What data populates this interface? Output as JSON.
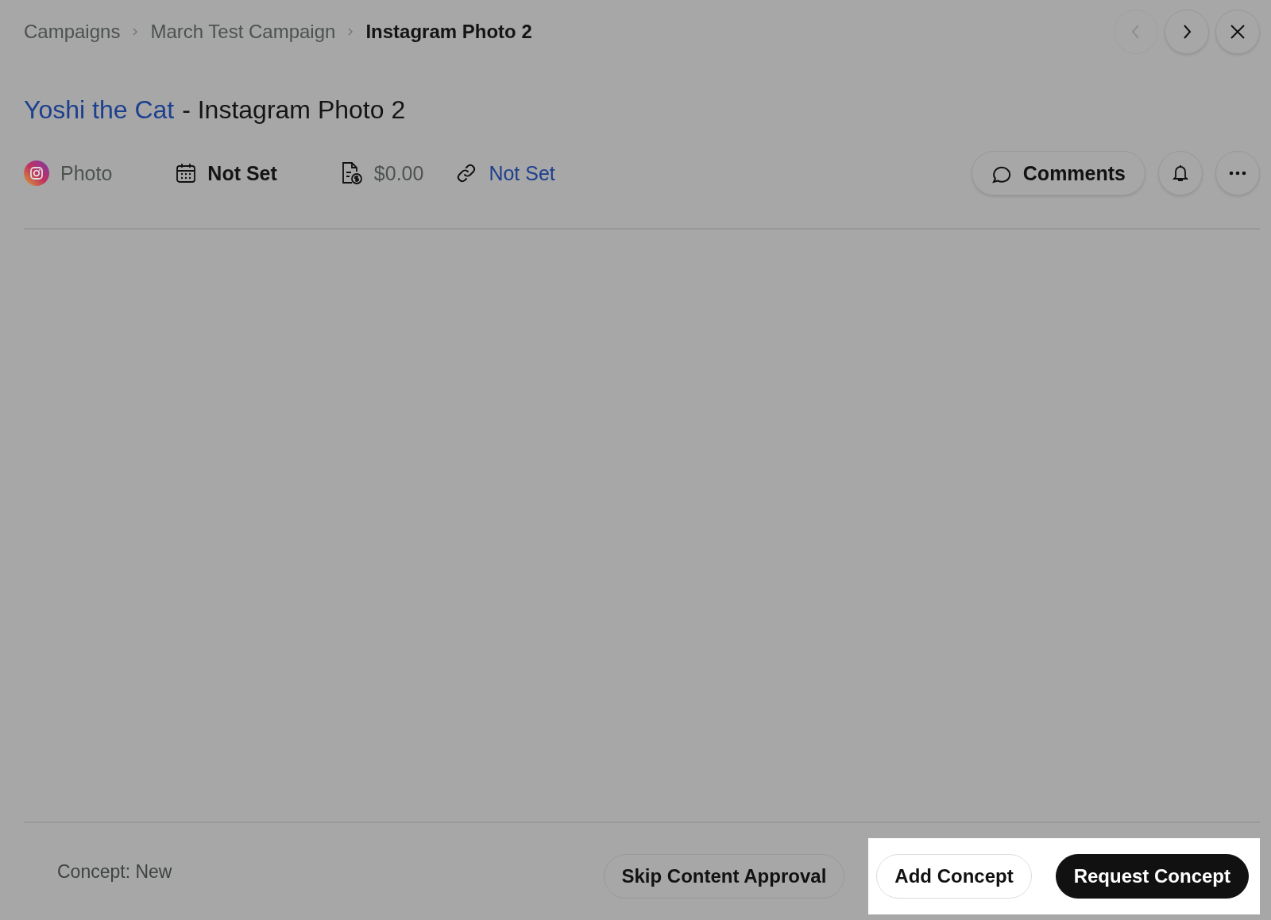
{
  "breadcrumb": [
    {
      "label": "Campaigns",
      "current": false
    },
    {
      "label": "March Test Campaign",
      "current": false
    },
    {
      "label": "Instagram Photo 2",
      "current": true
    }
  ],
  "nav_buttons": [
    {
      "kind": "prev",
      "disabled": true
    },
    {
      "kind": "next",
      "disabled": false
    },
    {
      "kind": "close",
      "disabled": false
    }
  ],
  "title": {
    "link": "Yoshi the Cat",
    "rest": "- Instagram Photo 2"
  },
  "meta": [
    {
      "kind": "platform",
      "text": "Photo"
    },
    {
      "kind": "date",
      "text": "Not Set"
    },
    {
      "kind": "price",
      "text": "$0.00"
    },
    {
      "kind": "link",
      "text": "Not Set"
    }
  ],
  "actions": {
    "comments": "Comments"
  },
  "footer": {
    "status": "Concept: New",
    "buttons": [
      {
        "label": "Skip Content Approval",
        "kind": "outline",
        "highlighted": false
      },
      {
        "label": "Add Concept",
        "kind": "light",
        "highlighted": true
      },
      {
        "label": "Request Concept",
        "kind": "dark",
        "highlighted": true
      }
    ]
  }
}
